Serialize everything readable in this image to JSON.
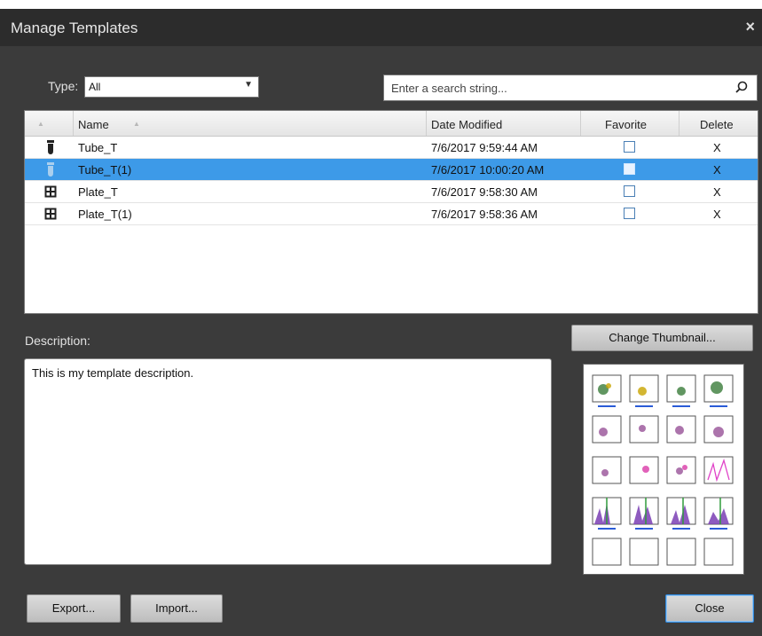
{
  "window": {
    "title": "Manage Templates",
    "close_glyph": "×"
  },
  "filter": {
    "type_label": "Type:",
    "type_value": "All",
    "search_placeholder": "Enter a search string..."
  },
  "table": {
    "headers": {
      "name": "Name",
      "date": "Date Modified",
      "favorite": "Favorite",
      "delete": "Delete"
    },
    "rows": [
      {
        "icon": "tube-icon",
        "name": "Tube_T",
        "date": "7/6/2017 9:59:44 AM",
        "favorite": false,
        "delete": "X",
        "selected": false
      },
      {
        "icon": "tube-icon",
        "name": "Tube_T(1)",
        "date": "7/6/2017 10:00:20 AM",
        "favorite": false,
        "delete": "X",
        "selected": true
      },
      {
        "icon": "plate-icon",
        "name": "Plate_T",
        "date": "7/6/2017 9:58:30 AM",
        "favorite": false,
        "delete": "X",
        "selected": false
      },
      {
        "icon": "plate-icon",
        "name": "Plate_T(1)",
        "date": "7/6/2017 9:58:36 AM",
        "favorite": false,
        "delete": "X",
        "selected": false
      }
    ]
  },
  "description": {
    "label": "Description:",
    "text": "This is my template description."
  },
  "buttons": {
    "change_thumbnail": "Change Thumbnail...",
    "export": "Export...",
    "import": "Import...",
    "close": "Close"
  },
  "colors": {
    "selection": "#3d9ae8",
    "window_bg": "#3b3b3b",
    "titlebar_bg": "#2c2c2c"
  }
}
